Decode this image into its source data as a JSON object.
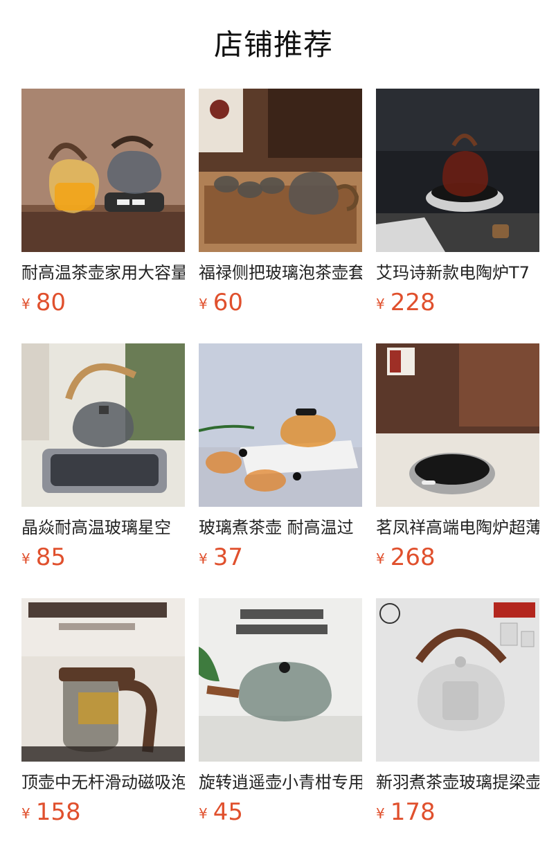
{
  "header": {
    "title": "店铺推荐"
  },
  "colors": {
    "price": "#e0502d",
    "text": "#222222",
    "title": "#111111"
  },
  "products": [
    {
      "name": "耐高温茶壶家用大容量",
      "currency": "¥",
      "price": "80",
      "image_icon": "glass-teapot-and-stove-image"
    },
    {
      "name": "福禄侧把玻璃泡茶壶套",
      "currency": "¥",
      "price": "60",
      "image_icon": "glass-teapot-set-image"
    },
    {
      "name": "艾玛诗新款电陶炉T7",
      "currency": "¥",
      "price": "228",
      "image_icon": "electric-ceramic-stove-image"
    },
    {
      "name": "晶焱耐高温玻璃星空",
      "currency": "¥",
      "price": "85",
      "image_icon": "kettle-on-mirror-stove-image"
    },
    {
      "name": "玻璃煮茶壶 耐高温过",
      "currency": "¥",
      "price": "37",
      "image_icon": "glass-teapot-and-cups-image"
    },
    {
      "name": "茗凤祥高端电陶炉超薄",
      "currency": "¥",
      "price": "268",
      "image_icon": "round-electric-stove-image"
    },
    {
      "name": "顶壶中无杆滑动磁吸泡",
      "currency": "¥",
      "price": "158",
      "image_icon": "magnetic-tea-maker-image"
    },
    {
      "name": "旋转逍遥壶小青柑专用",
      "currency": "¥",
      "price": "45",
      "image_icon": "rotating-glass-teapot-image"
    },
    {
      "name": "新羽煮茶壶玻璃提梁壶",
      "currency": "¥",
      "price": "178",
      "image_icon": "glass-loop-handle-kettle-image"
    }
  ]
}
